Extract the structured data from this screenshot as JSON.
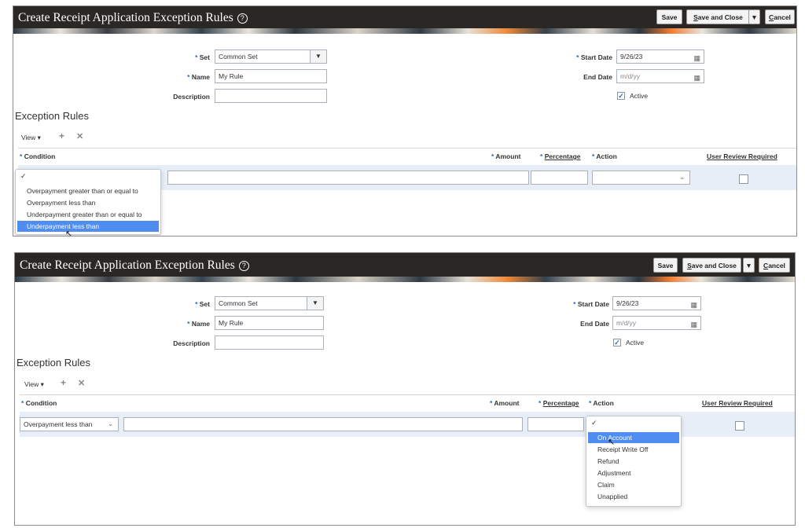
{
  "app": {
    "title": "Create Receipt Application Exception Rules",
    "help_icon": "?",
    "save_label": "Save",
    "save_close_label": "Save and Close",
    "split_arrow": "▼",
    "cancel_label": "Cancel"
  },
  "form": {
    "required_mark": "*",
    "set_label": "Set",
    "set_value": "Common Set",
    "name_label": "Name",
    "name_value": "My Rule",
    "description_label": "Description",
    "description_value": "",
    "start_date_label": "Start Date",
    "start_date_value": "9/26/23",
    "end_date_label": "End Date",
    "end_date_placeholder": "m/d/yy",
    "active_label": "Active",
    "active_checked": "✓"
  },
  "exception_rules": {
    "section_title": "Exception Rules",
    "view_label": "View ▾",
    "add_icon": "+",
    "delete_icon": "✕",
    "columns": {
      "condition": "Condition",
      "amount": "Amount",
      "percentage": "Percentage",
      "action": "Action",
      "user_review": "User Review Required"
    }
  },
  "screen1": {
    "condition_options": [
      "Overpayment greater than or equal to",
      "Overpayment less than",
      "Underpayment greater than or equal to",
      "Underpayment less than"
    ],
    "selected_option": "Underpayment less than",
    "check_mark": "✓"
  },
  "screen2": {
    "condition_value": "Overpayment less than",
    "action_options": [
      "On Account",
      "Receipt Write Off",
      "Refund",
      "Adjustment",
      "Claim",
      "Unapplied"
    ],
    "selected_option": "On Account",
    "check_mark": "✓"
  }
}
